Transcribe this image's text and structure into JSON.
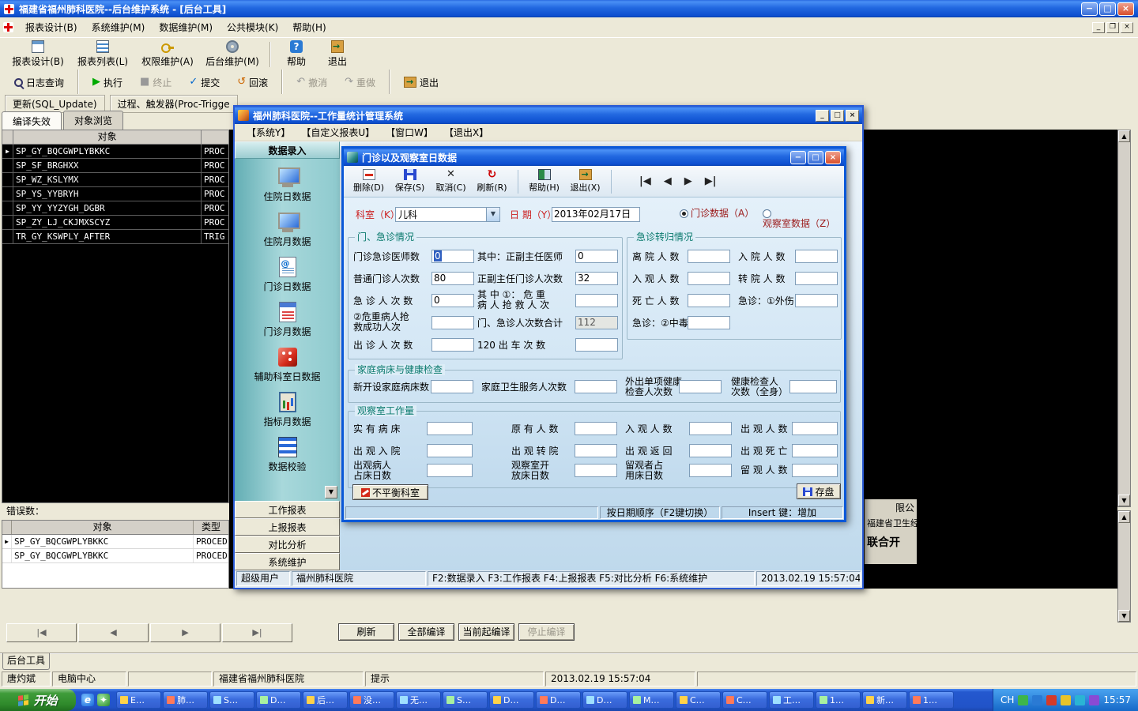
{
  "main": {
    "title": "福建省福州肺科医院--后台维护系统 - [后台工具]",
    "menu": [
      "报表设计(B)",
      "系统维护(M)",
      "数据维护(M)",
      "公共模块(K)",
      "帮助(H)"
    ],
    "tb1": [
      "报表设计(B)",
      "报表列表(L)",
      "权限维护(A)",
      "后台维护(M)",
      "帮助",
      "退出"
    ],
    "tb2": [
      "日志查询",
      "执行",
      "终止",
      "提交",
      "回滚",
      "撤消",
      "重做",
      "退出"
    ],
    "modes": [
      "更新(SQL_Update)",
      "过程、触发器(Proc-Trigge"
    ],
    "tabs": [
      "编译失效",
      "对象浏览"
    ],
    "grid1": {
      "header": "对象",
      "rows": [
        {
          "name": "SP_GY_BQCGWPLYBKKC",
          "type": "PROC"
        },
        {
          "name": "SP_SF_BRGHXX",
          "type": "PROC"
        },
        {
          "name": "SP_WZ_KSLYMX",
          "type": "PROC"
        },
        {
          "name": "SP_YS_YYBRYH",
          "type": "PROC"
        },
        {
          "name": "SP_YY_YYZYGH_DGBR",
          "type": "PROC"
        },
        {
          "name": "SP_ZY_LJ_CKJMXSCYZ",
          "type": "PROC"
        },
        {
          "name": "TR_GY_KSWPLY_AFTER",
          "type": "TRIG"
        }
      ]
    },
    "error_label": "错误数：",
    "grid2": {
      "headers": [
        "对象",
        "类型"
      ],
      "rows": [
        {
          "name": "SP_GY_BQCGWPLYBKKC",
          "type": "PROCED"
        },
        {
          "name": "SP_GY_BQCGWPLYBKKC",
          "type": "PROCED"
        }
      ]
    },
    "nav_glyphs": [
      "|◀",
      "◀",
      "▶",
      "▶|"
    ],
    "compile_buttons": [
      "刷新",
      "全部编译",
      "当前起编译",
      "停止编译"
    ],
    "bottom_tab": "后台工具",
    "status": [
      "唐灼斌",
      "电脑中心",
      "福建省福州肺科医院",
      "提示",
      "2013.02.19 15:57:04"
    ],
    "fragments": [
      "限公",
      "福建省卫生经济协",
      "联合开"
    ]
  },
  "child": {
    "title": "福州肺科医院--工作量统计管理系统",
    "menu": [
      "【系统Y】",
      "【自定义报表U】",
      "【窗口W】",
      "【退出X】"
    ],
    "sidebar": {
      "header": "数据录入",
      "items": [
        "住院日数据",
        "住院月数据",
        "门诊日数据",
        "门诊月数据",
        "辅助科室日数据",
        "指标月数据",
        "数据校验"
      ],
      "groups": [
        "工作报表",
        "上报报表",
        "对比分析",
        "系统维护"
      ]
    },
    "status": [
      "超级用户",
      "福州肺科医院",
      "F2:数据录入 F3:工作报表 F4:上报报表 F5:对比分析 F6:系统维护",
      "2013.02.19 15:57:04"
    ]
  },
  "dialog": {
    "title": "门诊以及观察室日数据",
    "toolbar": [
      "删除(D)",
      "保存(S)",
      "取消(C)",
      "刷新(R)",
      "帮助(H)",
      "退出(X)"
    ],
    "nav": [
      "|◀",
      "◀",
      "▶",
      "▶|"
    ],
    "dept_label": "科室（K）：",
    "dept_value": "儿科",
    "date_label": "日 期（Y）：",
    "date_value": "2013年02月17日",
    "radios": [
      "门诊数据（A）",
      "观察室数据（Z）"
    ],
    "g1": {
      "title": "门、急诊情况",
      "items": [
        {
          "label": "门诊急诊医师数",
          "value": "0"
        },
        {
          "label": "其中：正副主任医师",
          "value": "0"
        },
        {
          "label": "普通门诊人次数",
          "value": "80"
        },
        {
          "label": "正副主任门诊人次数",
          "value": "32"
        },
        {
          "label": "急 诊 人 次 数",
          "value": "0"
        },
        {
          "label": "其 中 ①： 危 重\n病 人 抢 救 人 次",
          "value": ""
        },
        {
          "label": "②危重病人抢\n救成功人次",
          "value": ""
        },
        {
          "label": "门、急诊人次数合计",
          "value": "112"
        },
        {
          "label": "出 诊 人 次 数",
          "value": ""
        },
        {
          "label": "120 出 车 次 数",
          "value": ""
        }
      ]
    },
    "g2": {
      "title": "急诊转归情况",
      "items": [
        {
          "label": "离 院 人 数",
          "value": ""
        },
        {
          "label": "入 院 人 数",
          "value": ""
        },
        {
          "label": "入 观 人 数",
          "value": ""
        },
        {
          "label": "转 院 人 数",
          "value": ""
        },
        {
          "label": "死 亡 人 数",
          "value": ""
        },
        {
          "label": "急诊：①外伤",
          "value": ""
        },
        {
          "label": "急诊：②中毒",
          "value": ""
        }
      ]
    },
    "g3": {
      "title": "家庭病床与健康检查",
      "items": [
        {
          "label": "新开设家庭病床数",
          "value": ""
        },
        {
          "label": "家庭卫生服务人次数",
          "value": ""
        },
        {
          "label": "外出单项健康\n检查人次数",
          "value": ""
        },
        {
          "label": "健康检查人\n次数（全身）",
          "value": ""
        }
      ]
    },
    "g4": {
      "title": "观察室工作量",
      "items": [
        {
          "label": "实 有 病 床",
          "value": ""
        },
        {
          "label": "原 有 人 数",
          "value": ""
        },
        {
          "label": "入 观 人 数",
          "value": ""
        },
        {
          "label": "出 观 人 数",
          "value": ""
        },
        {
          "label": "出 观 入 院",
          "value": ""
        },
        {
          "label": "出 观 转 院",
          "value": ""
        },
        {
          "label": "出 观 返 回",
          "value": ""
        },
        {
          "label": "出 观 死 亡",
          "value": ""
        },
        {
          "label": "出观病人\n占床日数",
          "value": ""
        },
        {
          "label": "观察室开\n放床日数",
          "value": ""
        },
        {
          "label": "留观者占\n用床日数",
          "value": ""
        },
        {
          "label": "留 观 人 数",
          "value": ""
        }
      ]
    },
    "unbalanced_button": "不平衡科室",
    "save_button": "存盘",
    "status": [
      "按日期顺序（F2键切换）",
      "Insert 键：增加"
    ]
  },
  "taskbar": {
    "start": "开始",
    "buttons": [
      "E…",
      "肺…",
      "S…",
      "D…",
      "后…",
      "没…",
      "无…",
      "S…",
      "D…",
      "D…",
      "D…",
      "M…",
      "C…",
      "C…",
      "工…",
      "1…",
      "新…",
      "1…"
    ],
    "lang": "CH",
    "time": "15:57"
  }
}
